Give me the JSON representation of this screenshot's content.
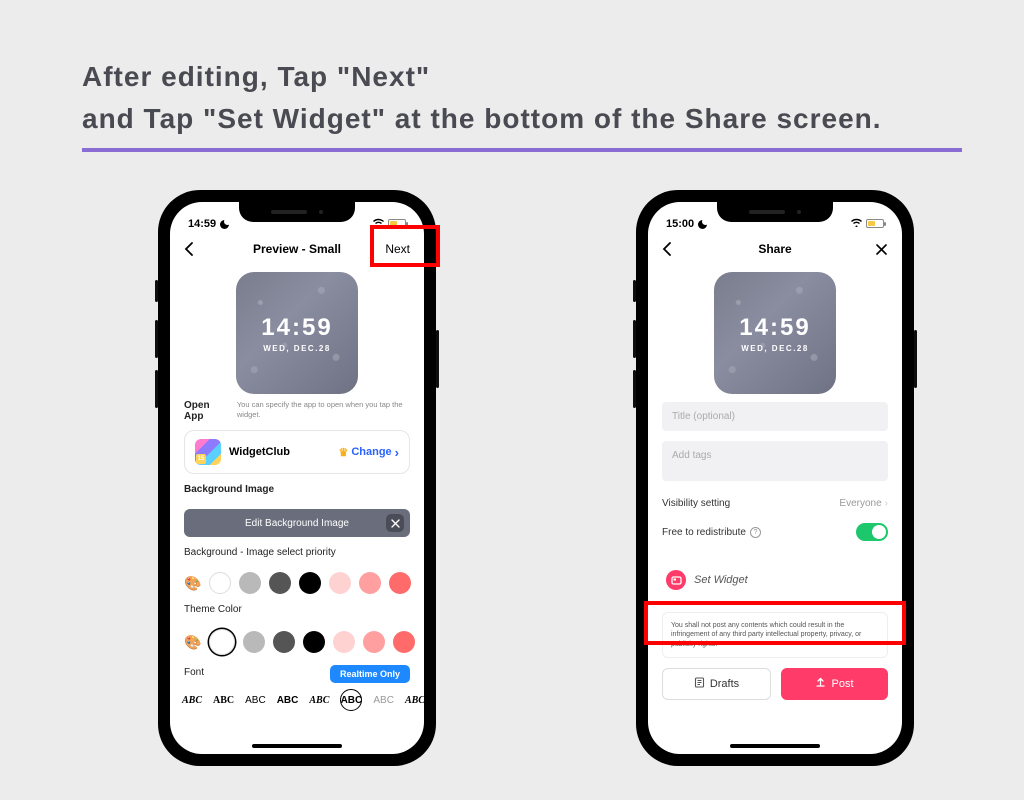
{
  "instruction": {
    "line1": "After editing, Tap \"Next\"",
    "line2": "and Tap \"Set Widget\" at the bottom of the Share screen."
  },
  "colors": {
    "accent_purple": "#8a6dd4",
    "accent_pink": "#ff3b6a",
    "link_blue": "#2a62ff",
    "toggle_green": "#1dc76b",
    "highlight_red": "#ff0000"
  },
  "phone_left": {
    "status": {
      "time": "14:59"
    },
    "nav": {
      "title": "Preview - Small",
      "next_label": "Next"
    },
    "widget_preview": {
      "time": "14:59",
      "date": "WED, DEC.28"
    },
    "open_app": {
      "label": "Open App",
      "help": "You can specify the app to open when you tap the widget.",
      "app_name": "WidgetClub",
      "change_label": "Change",
      "app_badge": "15"
    },
    "bg_image": {
      "label": "Background Image",
      "button": "Edit Background Image"
    },
    "bg_priority_label": "Background - Image select priority",
    "theme_color_label": "Theme Color",
    "font": {
      "label": "Font",
      "realtime_label": "Realtime Only",
      "samples": [
        "ABC",
        "ABC",
        "ABC",
        "ABC",
        "ABC",
        "ABC",
        "ABC",
        "ABC"
      ]
    }
  },
  "phone_right": {
    "status": {
      "time": "15:00"
    },
    "nav": {
      "title": "Share"
    },
    "widget_preview": {
      "time": "14:59",
      "date": "WED, DEC.28"
    },
    "title_placeholder": "Title (optional)",
    "tags_placeholder": "Add tags",
    "visibility": {
      "label": "Visibility setting",
      "value": "Everyone"
    },
    "redistribute": {
      "label": "Free to redistribute",
      "value": true
    },
    "set_widget_label": "Set Widget",
    "disclaimer": "You shall not post any contents which could result in the infringement of any third party intellectual property, privacy, or publicity rights.",
    "drafts_label": "Drafts",
    "post_label": "Post"
  }
}
